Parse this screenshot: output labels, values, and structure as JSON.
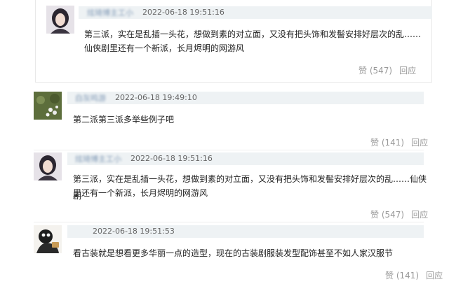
{
  "comments": [
    {
      "username": "炫琦博主工小",
      "time": "2022-06-18 19:51:16",
      "text_line1": "第三派，实在是乱插一头花，想做到素的对立面，又没有把头饰和发髻安排好层次的乱……",
      "text_line2": "仙侠剧里还有一个新派，长月烬明的网游风",
      "like_label": "赞 (547)",
      "reply_label": "回应"
    },
    {
      "username": "白灰鸣游",
      "time": "2022-06-18 19:49:10",
      "text_line1": "第二派第三派多举些例子吧",
      "like_label": "赞 (141)",
      "reply_label": "回应"
    },
    {
      "username": "炫琦博主工小",
      "time": "2022-06-18 19:51:16",
      "text_line1": "第三派，实在是乱插一头花，想做到素的对立面，又没有把头饰和发髻安排好层次的乱……仙侠剧",
      "text_line2": "里还有一个新派，长月烬明的网游风",
      "like_label": "赞 (547)",
      "reply_label": "回应"
    },
    {
      "username": "",
      "time": "2022-06-18 19:51:53",
      "text_line1": "看古装就是想看更多华丽一点的造型，现在的古装剧服装发型配饰甚至不如人家汉服节",
      "like_label": "赞 (141)",
      "reply_label": "回应"
    }
  ]
}
